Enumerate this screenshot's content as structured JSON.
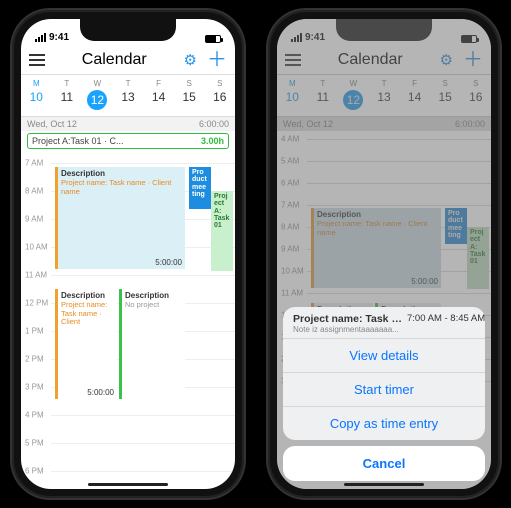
{
  "status": {
    "time": "9:41"
  },
  "nav": {
    "title": "Calendar"
  },
  "week": {
    "days": [
      {
        "dow": "M",
        "num": "10",
        "highlight": true
      },
      {
        "dow": "T",
        "num": "11"
      },
      {
        "dow": "W",
        "num": "12",
        "today": true
      },
      {
        "dow": "T",
        "num": "13"
      },
      {
        "dow": "F",
        "num": "14"
      },
      {
        "dow": "S",
        "num": "15"
      },
      {
        "dow": "S",
        "num": "16"
      }
    ]
  },
  "allday": {
    "date": "Wed, Oct 12",
    "total": "6:00:00"
  },
  "allday_chip": {
    "label": "Project A:Task 01 · C...",
    "dur": "3.00h"
  },
  "hours": [
    "7 AM",
    "8 AM",
    "9 AM",
    "10 AM",
    "11 AM",
    "12 PM",
    "1 PM",
    "2 PM",
    "3 PM",
    "4 PM",
    "5 PM",
    "6 PM"
  ],
  "events": {
    "e1": {
      "title": "Description",
      "sub": "Project name: Task name · Client name",
      "timer": "5:00:00"
    },
    "e2": {
      "title": "Pro\nduct\nmee\nting"
    },
    "e3": {
      "title": "Proj\nect\nA:\nTask\n01"
    },
    "e4": {
      "title": "Description",
      "sub": "Project name: Task name · Client",
      "timer": "5:00:00"
    },
    "e5": {
      "title": "Description",
      "sub": "No project"
    }
  },
  "right_hours_top": [
    "4 AM",
    "5 AM",
    "6 AM"
  ],
  "sheet": {
    "title": "Project name: Task - Cli...",
    "note": "Note iz assignmentaaaaaaa...",
    "time": "7:00 AM - 8:45 AM",
    "item1": "View details",
    "item2": "Start timer",
    "item3": "Copy as time entry",
    "cancel": "Cancel"
  }
}
